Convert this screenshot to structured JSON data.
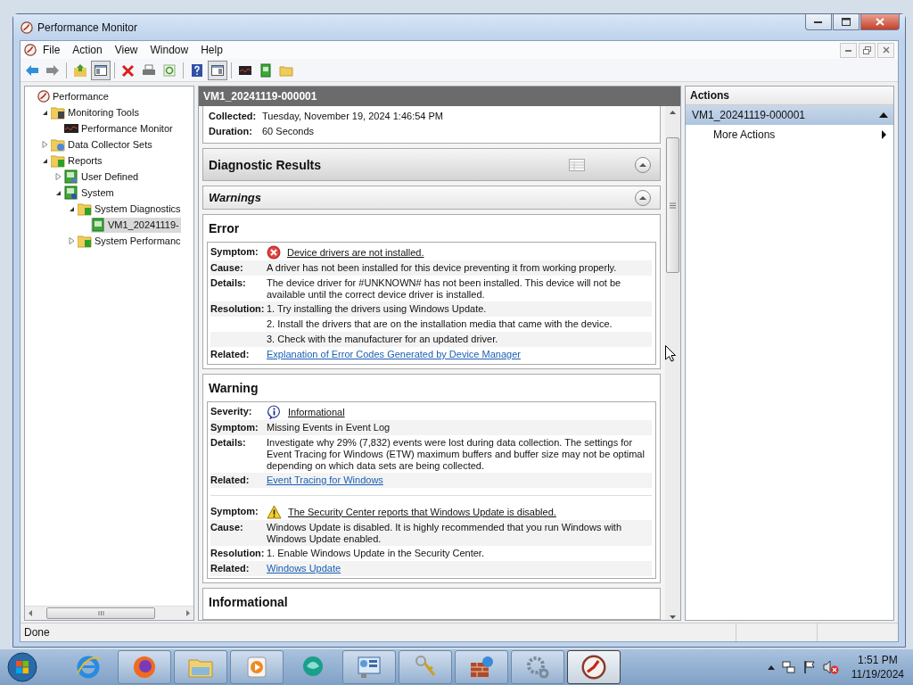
{
  "window": {
    "title": "Performance Monitor"
  },
  "menu": [
    {
      "label": "File"
    },
    {
      "label": "Action"
    },
    {
      "label": "View"
    },
    {
      "label": "Window"
    },
    {
      "label": "Help"
    }
  ],
  "toolbar": [
    [
      {
        "kind": "back",
        "pressed": false
      },
      {
        "kind": "forward",
        "pressed": false
      }
    ],
    [
      {
        "kind": "up",
        "pressed": false
      },
      {
        "kind": "tree-toggle",
        "pressed": true
      }
    ],
    [
      {
        "kind": "delete",
        "pressed": false
      },
      {
        "kind": "print",
        "pressed": false
      },
      {
        "kind": "refresh",
        "pressed": false
      }
    ],
    [
      {
        "kind": "help",
        "pressed": false
      },
      {
        "kind": "pane-toggle",
        "pressed": true
      }
    ],
    [
      {
        "kind": "chart",
        "pressed": false
      },
      {
        "kind": "report",
        "pressed": false
      },
      {
        "kind": "folder",
        "pressed": false
      }
    ]
  ],
  "tree": [
    {
      "label": "Performance",
      "kind": "root",
      "selected": false,
      "children": [
        {
          "label": "Monitoring Tools",
          "kind": "tools",
          "selected": false,
          "expanded": true,
          "children": [
            {
              "label": "Performance Monitor",
              "kind": "chart",
              "selected": false
            }
          ]
        },
        {
          "label": "Data Collector Sets",
          "kind": "collector",
          "selected": false,
          "expanded": false
        },
        {
          "label": "Reports",
          "kind": "reports",
          "selected": false,
          "expanded": true,
          "children": [
            {
              "label": "User Defined",
              "kind": "user",
              "selected": false,
              "expanded": false
            },
            {
              "label": "System",
              "kind": "system",
              "selected": false,
              "expanded": true,
              "children": [
                {
                  "label": "System Diagnostics",
                  "kind": "reports",
                  "selected": false,
                  "expanded": true,
                  "children": [
                    {
                      "label": "VM1_20241119-",
                      "kind": "report",
                      "selected": true
                    }
                  ]
                },
                {
                  "label": "System Performanc",
                  "kind": "reports",
                  "selected": false,
                  "expanded": false
                }
              ]
            }
          ]
        }
      ]
    }
  ],
  "report": {
    "title": "VM1_20241119-000001",
    "summary": [
      {
        "label": "Collected:",
        "value": "Tuesday, November 19, 2024 1:46:54 PM"
      },
      {
        "label": "Duration:",
        "value": "60 Seconds"
      }
    ],
    "sections": [
      {
        "title": "Diagnostic Results",
        "kind": "main",
        "expanded": true
      },
      {
        "title": "Warnings",
        "kind": "sub",
        "expanded": true
      }
    ],
    "groups": [
      {
        "title": "Error",
        "findings": [
          {
            "rows": [
              {
                "label": "Symptom:",
                "kind": "error",
                "text": "Device drivers are not installed."
              },
              {
                "label": "Cause:",
                "kind": "text",
                "text": "A driver has not been installed for this device preventing it from working properly."
              },
              {
                "label": "Details:",
                "kind": "text",
                "text": "The device driver for #UNKNOWN# has not been installed. This device will not be available until the correct device driver is installed."
              },
              {
                "label": "Resolution:",
                "kind": "text",
                "text": "1. Try installing the drivers using Windows Update."
              },
              {
                "kind": "text",
                "text": "2. Install the drivers that are on the installation media that came with the device."
              },
              {
                "kind": "text",
                "text": "3. Check with the manufacturer for an updated driver."
              },
              {
                "label": "Related:",
                "kind": "link",
                "text": "Explanation of Error Codes Generated by Device Manager"
              }
            ]
          }
        ]
      },
      {
        "title": "Warning",
        "findings": [
          {
            "rows": [
              {
                "label": "Severity:",
                "kind": "info",
                "text": "Informational"
              },
              {
                "label": "Symptom:",
                "kind": "text",
                "text": "Missing Events in Event Log"
              },
              {
                "label": "Details:",
                "kind": "text",
                "text": "Investigate why 29% (7,832) events were lost during data collection. The settings for Event Tracing for Windows (ETW) maximum buffers and buffer size may not be optimal depending on which data sets are being collected."
              },
              {
                "label": "Related:",
                "kind": "link",
                "text": "Event Tracing for Windows"
              }
            ]
          },
          {
            "rows": [
              {
                "label": "Symptom:",
                "kind": "warning",
                "text": "The Security Center reports that Windows Update is disabled."
              },
              {
                "label": "Cause:",
                "kind": "text",
                "text": "Windows Update is disabled. It is highly recommended that you run Windows with Windows Update enabled."
              },
              {
                "label": "Resolution:",
                "kind": "text",
                "text": "1. Enable Windows Update in the Security Center."
              },
              {
                "label": "Related:",
                "kind": "link",
                "text": "Windows Update"
              }
            ]
          }
        ]
      },
      {
        "title": "Informational"
      }
    ]
  },
  "actions": {
    "title": "Actions",
    "groups": [
      {
        "title": "VM1_20241119-000001",
        "expanded": true,
        "items": [
          {
            "label": "More Actions",
            "kind": "submenu"
          }
        ]
      }
    ]
  },
  "status_bar": {
    "text": "Done"
  },
  "taskbar": {
    "apps": [
      {
        "kind": "ie",
        "selected": false
      },
      {
        "kind": "firefox",
        "selected": false
      },
      {
        "kind": "explorer",
        "selected": false
      },
      {
        "kind": "media",
        "selected": false
      },
      {
        "kind": "chat",
        "selected": false
      },
      {
        "kind": "panel",
        "selected": false
      },
      {
        "kind": "keys",
        "selected": false
      },
      {
        "kind": "firewall",
        "selected": false
      },
      {
        "kind": "gears",
        "selected": false
      },
      {
        "kind": "perfmon",
        "selected": true
      }
    ],
    "clock": {
      "time": "1:51 PM",
      "date": "11/19/2024"
    }
  }
}
